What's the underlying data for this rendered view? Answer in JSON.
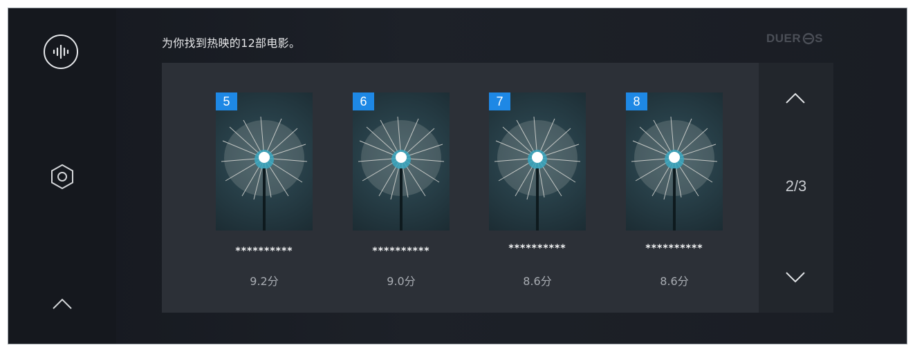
{
  "header": {
    "title": "为你找到热映的12部电影。",
    "logo_text": "DUER",
    "logo_suffix": "S"
  },
  "sidebar": {
    "voice_icon": "voice-waveform-icon",
    "settings_icon": "hexagon-settings-icon",
    "collapse_icon": "chevron-up-icon"
  },
  "pager": {
    "page_indicator": "2/3",
    "up_icon": "chevron-up-icon",
    "down_icon": "chevron-down-icon"
  },
  "movies": [
    {
      "index": "5",
      "title": "**********",
      "rating": "9.2分"
    },
    {
      "index": "6",
      "title": "**********",
      "rating": "9.0分"
    },
    {
      "index": "7",
      "title": "**********",
      "rating": "8.6分"
    },
    {
      "index": "8",
      "title": "**********",
      "rating": "8.6分"
    }
  ],
  "colors": {
    "badge": "#1e88e5",
    "panel": "#2c3037",
    "background": "#1d2128"
  }
}
